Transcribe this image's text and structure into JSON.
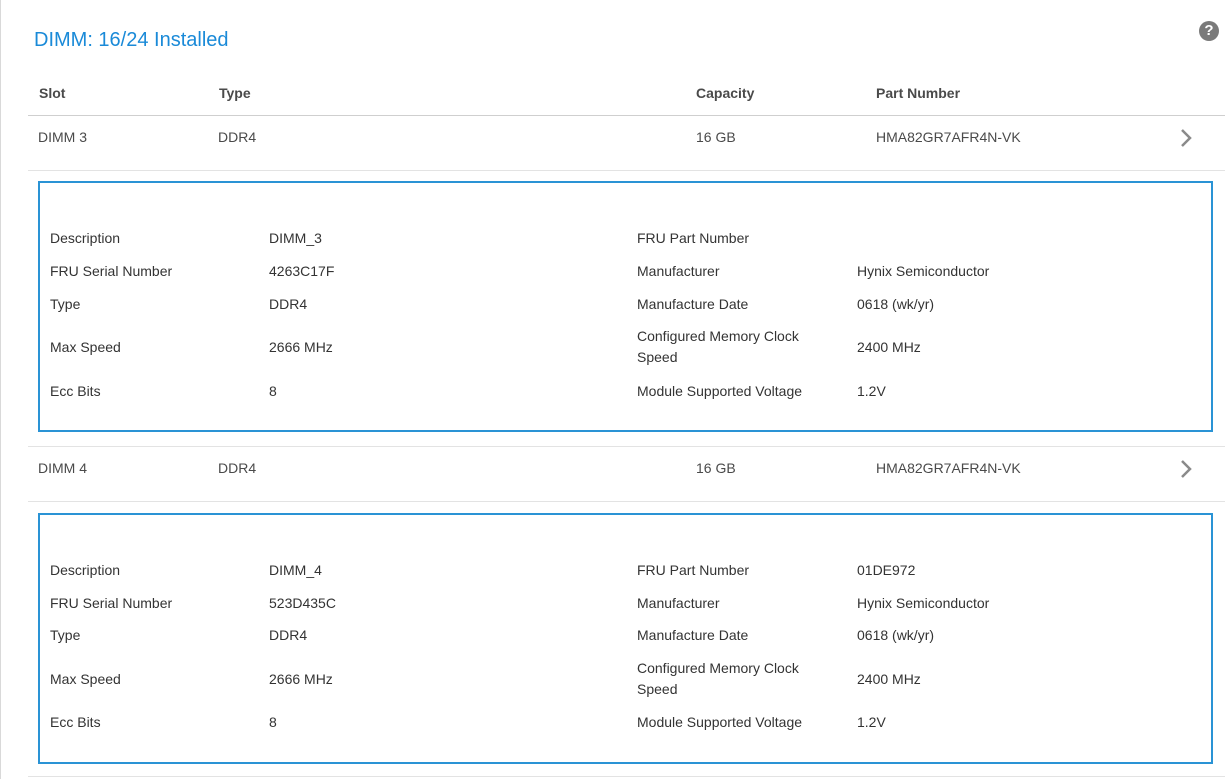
{
  "title": "DIMM: 16/24 Installed",
  "help_icon": "?",
  "columns": {
    "slot": "Slot",
    "type": "Type",
    "capacity": "Capacity",
    "part_number": "Part Number"
  },
  "rows": [
    {
      "slot": "DIMM 3",
      "type": "DDR4",
      "capacity": "16 GB",
      "part_number": "HMA82GR7AFR4N-VK",
      "details": {
        "description_label": "Description",
        "description": "DIMM_3",
        "fru_serial_label": "FRU Serial Number",
        "fru_serial": "4263C17F",
        "type_label": "Type",
        "type": "DDR4",
        "max_speed_label": "Max Speed",
        "max_speed": "2666 MHz",
        "ecc_label": "Ecc Bits",
        "ecc": "8",
        "fru_part_label": "FRU Part Number",
        "fru_part": "",
        "manufacturer_label": "Manufacturer",
        "manufacturer": "Hynix Semiconductor",
        "mfg_date_label": "Manufacture Date",
        "mfg_date": "0618 (wk/yr)",
        "clock_label": "Configured Memory Clock Speed",
        "clock": "2400 MHz",
        "voltage_label": "Module Supported Voltage",
        "voltage": "1.2V"
      }
    },
    {
      "slot": "DIMM 4",
      "type": "DDR4",
      "capacity": "16 GB",
      "part_number": "HMA82GR7AFR4N-VK",
      "details": {
        "description_label": "Description",
        "description": "DIMM_4",
        "fru_serial_label": "FRU Serial Number",
        "fru_serial": "523D435C",
        "type_label": "Type",
        "type": "DDR4",
        "max_speed_label": "Max Speed",
        "max_speed": "2666 MHz",
        "ecc_label": "Ecc Bits",
        "ecc": "8",
        "fru_part_label": "FRU Part Number",
        "fru_part": "01DE972",
        "manufacturer_label": "Manufacturer",
        "manufacturer": "Hynix Semiconductor",
        "mfg_date_label": "Manufacture Date",
        "mfg_date": "0618 (wk/yr)",
        "clock_label": "Configured Memory Clock Speed",
        "clock": "2400 MHz",
        "voltage_label": "Module Supported Voltage",
        "voltage": "1.2V"
      }
    }
  ],
  "colors": {
    "accent": "#1a8ad8",
    "detail_border": "#2a93d5"
  }
}
